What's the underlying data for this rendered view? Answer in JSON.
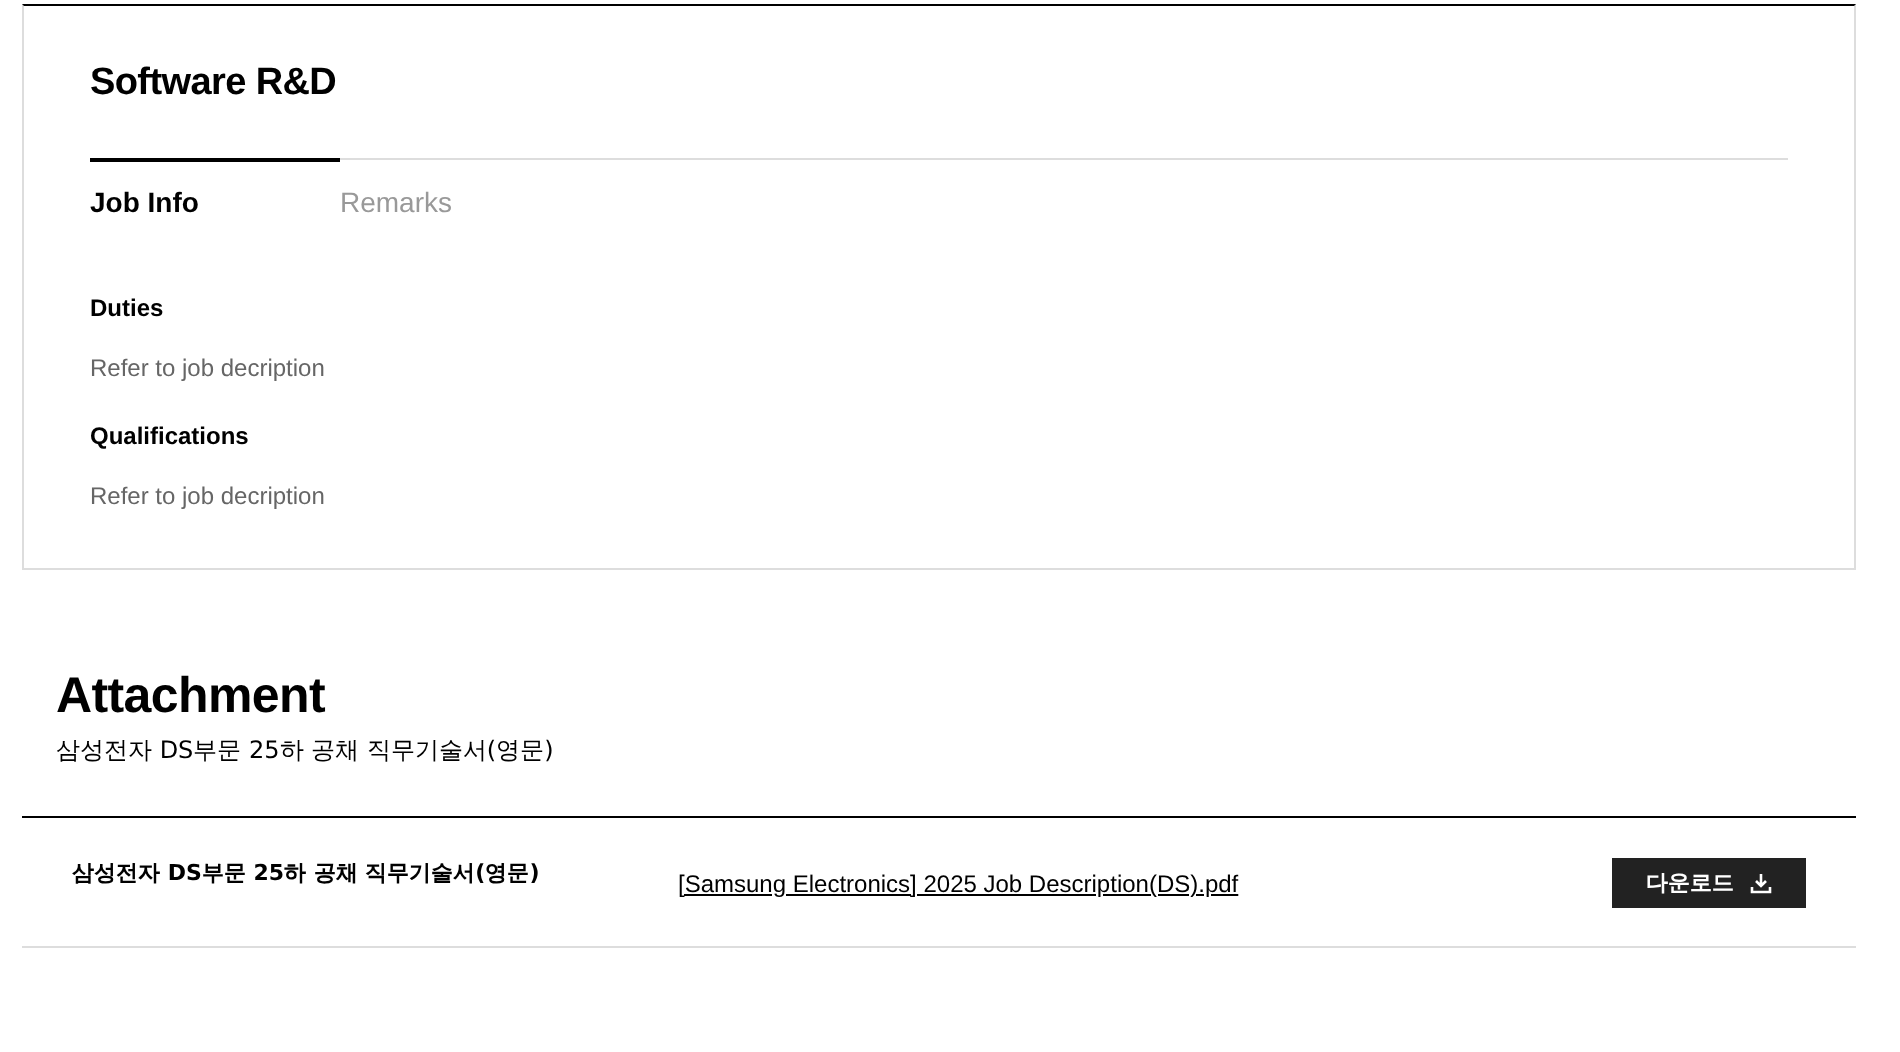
{
  "job": {
    "title": "Software R&D",
    "tabs": [
      {
        "label": "Job Info",
        "selected": true
      },
      {
        "label": "Remarks",
        "selected": false
      }
    ],
    "sections": [
      {
        "heading": "Duties",
        "text": "Refer to job decription"
      },
      {
        "heading": "Qualifications",
        "text": "Refer to job decription"
      }
    ]
  },
  "attachment": {
    "title": "Attachment",
    "subtitle": "삼성전자 DS부문 25하 공채 직무기술서(영문)",
    "files": [
      {
        "name": "삼성전자 DS부문 25하 공채 직무기술서(영문)",
        "link": "[Samsung Electronics] 2025 Job Description(DS).pdf",
        "button": "다운로드"
      }
    ]
  }
}
